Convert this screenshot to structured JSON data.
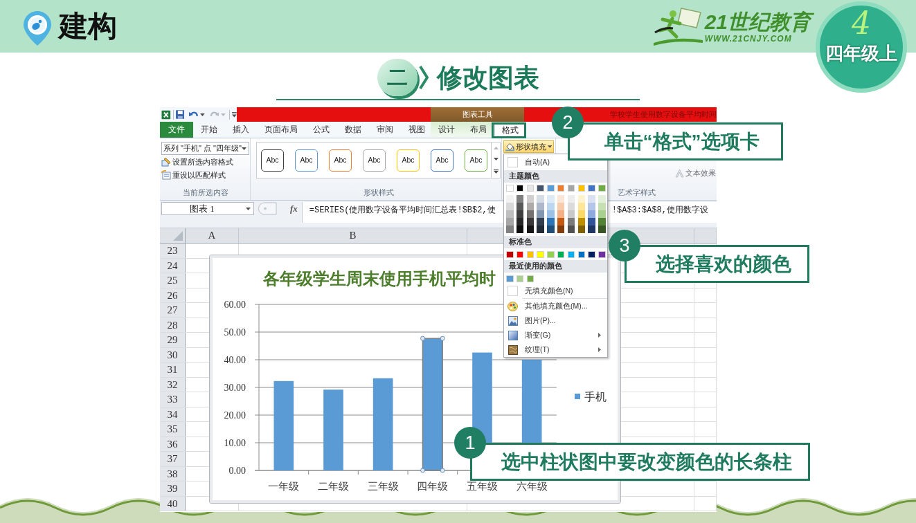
{
  "header": {
    "logo_text": "建构",
    "brand": {
      "name": "21世纪教育",
      "url": "WWW.21CNJY.COM"
    },
    "grade_badge": {
      "number": "4",
      "label": "四年级上"
    }
  },
  "section_title": {
    "number": "二",
    "text": "修改图表"
  },
  "excel": {
    "title_bar": {
      "context_label": "图表工具",
      "window_title": "学校学生使用数字设备平均时间"
    },
    "tabs": [
      {
        "label": "文件",
        "kind": "file",
        "selected": false
      },
      {
        "label": "开始",
        "kind": "main",
        "selected": false
      },
      {
        "label": "插入",
        "kind": "main",
        "selected": false
      },
      {
        "label": "页面布局",
        "kind": "main",
        "selected": false
      },
      {
        "label": "公式",
        "kind": "main",
        "selected": false
      },
      {
        "label": "数据",
        "kind": "main",
        "selected": false
      },
      {
        "label": "审阅",
        "kind": "main",
        "selected": false
      },
      {
        "label": "视图",
        "kind": "main",
        "selected": false
      },
      {
        "label": "设计",
        "kind": "context",
        "selected": false
      },
      {
        "label": "布局",
        "kind": "context",
        "selected": false
      },
      {
        "label": "格式",
        "kind": "context",
        "selected": true
      }
    ],
    "ribbon": {
      "selection_group": {
        "dropdown_value": "系列 \"手机\" 点 \"四年级\"",
        "commands": [
          {
            "label": "设置所选内容格式",
            "kind": "format"
          },
          {
            "label": "重设以匹配样式",
            "kind": "reset"
          }
        ],
        "label": "当前所选内容"
      },
      "shape_styles": {
        "items": [
          {
            "label": "Abc",
            "color": "#404040"
          },
          {
            "label": "Abc",
            "color": "#5b9bd5"
          },
          {
            "label": "Abc",
            "color": "#ed7d31"
          },
          {
            "label": "Abc",
            "color": "#a5a5a5"
          },
          {
            "label": "Abc",
            "color": "#ffc000"
          },
          {
            "label": "Abc",
            "color": "#4472c4"
          },
          {
            "label": "Abc",
            "color": "#70ad47"
          }
        ],
        "label": "形状样式"
      },
      "shape_fill": {
        "label": "形状填充",
        "expanded": true
      },
      "wordart": {
        "text_effects": "文本效果",
        "label": "艺术字样式"
      }
    },
    "formula_bar": {
      "name_box": "图表 1",
      "function_button": "fx",
      "formula_left": "=SERIES(使用数字设备平均时间汇总表!$B$2,使",
      "formula_right": "!$A$3:$A$8,使用数字设"
    },
    "sheet": {
      "columns": [
        "A",
        "B"
      ],
      "rows": [
        "23",
        "24",
        "25",
        "26",
        "27",
        "28",
        "29",
        "30",
        "31",
        "32",
        "33",
        "34",
        "35",
        "36",
        "37",
        "38",
        "39",
        "40"
      ],
      "chart": {
        "points": [
          {
            "selected": false
          },
          {
            "selected": false
          },
          {
            "selected": false
          },
          {
            "selected": true
          },
          {
            "selected": false
          },
          {
            "selected": false
          }
        ],
        "chart_data": {
          "type": "bar",
          "title": "各年级学生周末使用手机平均时",
          "categories": [
            "一年级",
            "二年级",
            "三年级",
            "四年级",
            "五年级",
            "六年级"
          ],
          "series": [
            {
              "name": "手机",
              "color": "#5b9bd5",
              "values": [
                32.3,
                29.2,
                33.3,
                47.7,
                42.6,
                40.0
              ]
            }
          ],
          "ylim": [
            0,
            60
          ],
          "yticks": [
            {
              "value": 0,
              "label": "0.00"
            },
            {
              "value": 10,
              "label": "10.00"
            },
            {
              "value": 20,
              "label": "20.00"
            },
            {
              "value": 30,
              "label": "30.00"
            },
            {
              "value": 40,
              "label": "40.00"
            },
            {
              "value": 50,
              "label": "50.00"
            },
            {
              "value": 60,
              "label": "60.00"
            }
          ],
          "grid": true
        }
      }
    },
    "fill_menu": {
      "auto_label": "自动(A)",
      "theme": {
        "title": "主题颜色",
        "swatches": [
          {
            "color": "#ffffff"
          },
          {
            "color": "#000000"
          },
          {
            "color": "#e7e6e6"
          },
          {
            "color": "#44546a"
          },
          {
            "color": "#5b9bd5"
          },
          {
            "color": "#ed7d31"
          },
          {
            "color": "#a5a5a5"
          },
          {
            "color": "#ffc000"
          },
          {
            "color": "#4472c4"
          },
          {
            "color": "#70ad47"
          }
        ],
        "shade_columns": [
          {
            "swatches": [
              {
                "color": "#f2f2f2"
              },
              {
                "color": "#d9d9d9"
              },
              {
                "color": "#bfbfbf"
              },
              {
                "color": "#a6a6a6"
              },
              {
                "color": "#808080"
              }
            ]
          },
          {
            "swatches": [
              {
                "color": "#7f7f7f"
              },
              {
                "color": "#595959"
              },
              {
                "color": "#404040"
              },
              {
                "color": "#262626"
              },
              {
                "color": "#0d0d0d"
              }
            ]
          },
          {
            "swatches": [
              {
                "color": "#d0cece"
              },
              {
                "color": "#aeaaaa"
              },
              {
                "color": "#757171"
              },
              {
                "color": "#3a3838"
              },
              {
                "color": "#171616"
              }
            ]
          },
          {
            "swatches": [
              {
                "color": "#d6dce4"
              },
              {
                "color": "#adb9ca"
              },
              {
                "color": "#8497b0"
              },
              {
                "color": "#333f4f"
              },
              {
                "color": "#222b35"
              }
            ]
          },
          {
            "swatches": [
              {
                "color": "#ddebf7"
              },
              {
                "color": "#bdd7ee"
              },
              {
                "color": "#9bc2e6"
              },
              {
                "color": "#2f75b5"
              },
              {
                "color": "#1f4e78"
              }
            ]
          },
          {
            "swatches": [
              {
                "color": "#fce4d6"
              },
              {
                "color": "#f8cbad"
              },
              {
                "color": "#f4b084"
              },
              {
                "color": "#c65911"
              },
              {
                "color": "#833c0c"
              }
            ]
          },
          {
            "swatches": [
              {
                "color": "#ededed"
              },
              {
                "color": "#dbdbdb"
              },
              {
                "color": "#c9c9c9"
              },
              {
                "color": "#7b7b7b"
              },
              {
                "color": "#525252"
              }
            ]
          },
          {
            "swatches": [
              {
                "color": "#fff2cc"
              },
              {
                "color": "#ffe699"
              },
              {
                "color": "#ffd966"
              },
              {
                "color": "#bf8f00"
              },
              {
                "color": "#806000"
              }
            ]
          },
          {
            "swatches": [
              {
                "color": "#d9e1f2"
              },
              {
                "color": "#b4c6e7"
              },
              {
                "color": "#8ea9db"
              },
              {
                "color": "#305496"
              },
              {
                "color": "#203764"
              }
            ]
          },
          {
            "swatches": [
              {
                "color": "#e2efda"
              },
              {
                "color": "#c6e0b4"
              },
              {
                "color": "#a9d08e"
              },
              {
                "color": "#548235"
              },
              {
                "color": "#375623"
              }
            ]
          }
        ]
      },
      "standard": {
        "title": "标准色",
        "swatches": [
          {
            "color": "#c00000"
          },
          {
            "color": "#ff0000"
          },
          {
            "color": "#ffc000"
          },
          {
            "color": "#ffff00"
          },
          {
            "color": "#92d050"
          },
          {
            "color": "#00b050"
          },
          {
            "color": "#00b0f0"
          },
          {
            "color": "#0070c0"
          },
          {
            "color": "#002060"
          },
          {
            "color": "#7030a0"
          }
        ]
      },
      "recent": {
        "title": "最近使用的颜色",
        "swatches": [
          {
            "color": "#5b9bd5"
          },
          {
            "color": "#a9d08e"
          },
          {
            "color": "#70ad47"
          }
        ]
      },
      "no_fill_label": "无填充颜色(N)",
      "items": [
        {
          "label": "其他填充颜色(M)...",
          "kind": "palette",
          "submenu": false
        },
        {
          "label": "图片(P)...",
          "kind": "picture",
          "submenu": false
        },
        {
          "label": "渐变(G)",
          "kind": "gradient",
          "submenu": true
        },
        {
          "label": "纹理(T)",
          "kind": "texture",
          "submenu": true
        }
      ]
    }
  },
  "callouts": [
    {
      "number": "2",
      "text": "单击“格式”选项卡"
    },
    {
      "number": "3",
      "text": "选择喜欢的颜色"
    },
    {
      "number": "1",
      "text": "选中柱状图中要改变颜色的长条柱"
    }
  ]
}
